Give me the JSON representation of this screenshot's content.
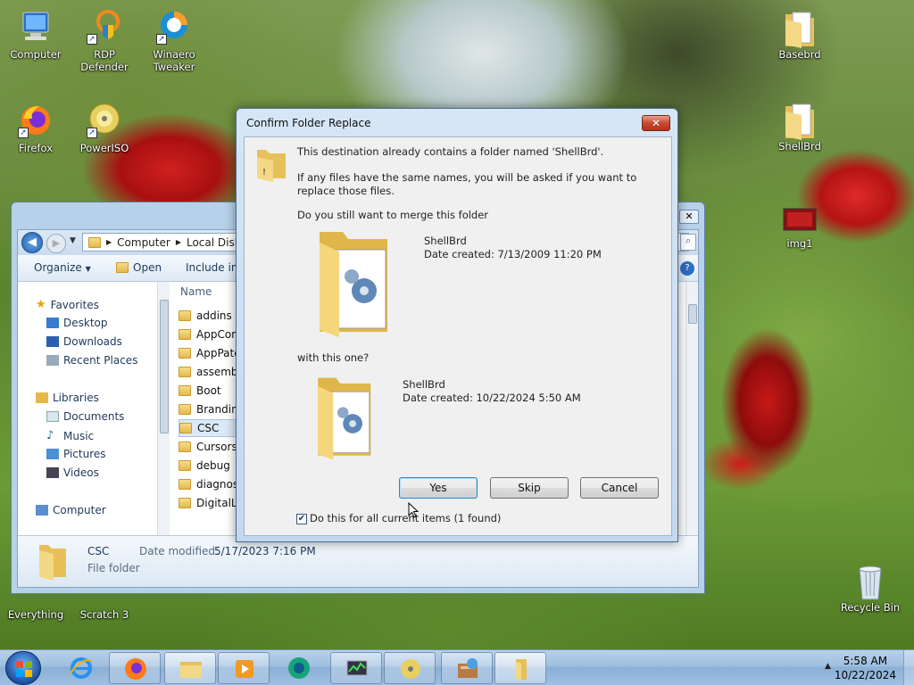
{
  "desktop": {
    "icons": [
      {
        "label": "Computer"
      },
      {
        "label": "RDP Defender"
      },
      {
        "label": "Winaero Tweaker"
      },
      {
        "label": "Firefox"
      },
      {
        "label": "PowerISO"
      },
      {
        "label": "Basebrd"
      },
      {
        "label": "ShellBrd"
      },
      {
        "label": "img1"
      },
      {
        "label": "Everything"
      },
      {
        "label": "Scratch 3"
      },
      {
        "label": "Recycle Bin"
      }
    ]
  },
  "explorer": {
    "breadcrumb": [
      "Computer",
      "Local Disk"
    ],
    "toolbar": {
      "organize": "Organize",
      "open": "Open",
      "include": "Include in"
    },
    "column_name": "Name",
    "nav": {
      "favorites": "Favorites",
      "desktop": "Desktop",
      "downloads": "Downloads",
      "recent": "Recent Places",
      "libraries": "Libraries",
      "documents": "Documents",
      "music": "Music",
      "pictures": "Pictures",
      "videos": "Videos",
      "computer": "Computer"
    },
    "files": [
      "addins",
      "AppCom",
      "AppPatc",
      "assembly",
      "Boot",
      "Branding",
      "CSC",
      "Cursors",
      "debug",
      "diagnost",
      "DigitalLo"
    ],
    "status": {
      "name": "CSC",
      "type": "File folder",
      "date_label": "Date modified:",
      "date_value": "5/17/2023 7:16 PM"
    }
  },
  "dialog": {
    "title": "Confirm Folder Replace",
    "close": "✕",
    "line1": "This destination already contains a folder named 'ShellBrd'.",
    "line2": "If any files have the same names, you will be asked if you want to replace those files.",
    "line3": "Do you still want to merge this folder",
    "existing": {
      "name": "ShellBrd",
      "date": "Date created: 7/13/2009 11:20 PM"
    },
    "with_text": "with this one?",
    "incoming": {
      "name": "ShellBrd",
      "date": "Date created: 10/22/2024 5:50 AM"
    },
    "buttons": {
      "yes": "Yes",
      "skip": "Skip",
      "cancel": "Cancel"
    },
    "checkbox": {
      "label": "Do this for all current items (1 found)",
      "checked": true
    }
  },
  "taskbar": {
    "clock": {
      "time": "5:58 AM",
      "date": "10/22/2024"
    }
  }
}
